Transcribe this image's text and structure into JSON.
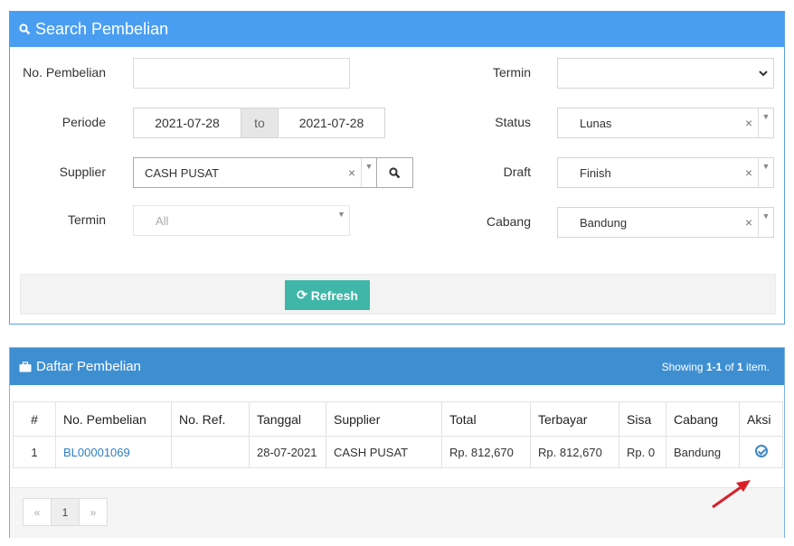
{
  "search_panel": {
    "title": "Search Pembelian",
    "fields": {
      "no_pembelian_label": "No. Pembelian",
      "no_pembelian_value": "",
      "periode_label": "Periode",
      "periode_from": "2021-07-28",
      "periode_to_label": "to",
      "periode_to": "2021-07-28",
      "supplier_label": "Supplier",
      "supplier_value": "CASH PUSAT",
      "termin_left_label": "Termin",
      "termin_left_value": "All",
      "termin_right_label": "Termin",
      "termin_right_value": "",
      "status_label": "Status",
      "status_value": "Lunas",
      "draft_label": "Draft",
      "draft_value": "Finish",
      "cabang_label": "Cabang",
      "cabang_value": "Bandung"
    },
    "refresh_label": "Refresh"
  },
  "list_panel": {
    "title": "Daftar Pembelian",
    "showing_prefix": "Showing ",
    "showing_range": "1-1",
    "showing_of": " of ",
    "showing_total": "1",
    "showing_suffix": " item.",
    "columns": [
      "#",
      "No. Pembelian",
      "No. Ref.",
      "Tanggal",
      "Supplier",
      "Total",
      "Terbayar",
      "Sisa",
      "Cabang",
      "Aksi"
    ],
    "rows": [
      {
        "num": "1",
        "no_pembelian": "BL00001069",
        "no_ref": "",
        "tanggal": "28-07-2021",
        "supplier": "CASH PUSAT",
        "total": "Rp. 812,670",
        "terbayar": "Rp. 812,670",
        "sisa": "Rp. 0",
        "cabang": "Bandung"
      }
    ],
    "pager": {
      "prev": "«",
      "current": "1",
      "next": "»"
    }
  },
  "colors": {
    "header_blue": "#4a9ef2",
    "list_header_blue": "#3e8fd2",
    "refresh_teal": "#3fb6a8",
    "arrow_red": "#d9202a"
  },
  "icons": [
    "search-icon",
    "x-clear-icon",
    "caret-down-icon",
    "briefcase-icon",
    "refresh-icon",
    "check-circle-icon",
    "red-arrow-icon"
  ]
}
